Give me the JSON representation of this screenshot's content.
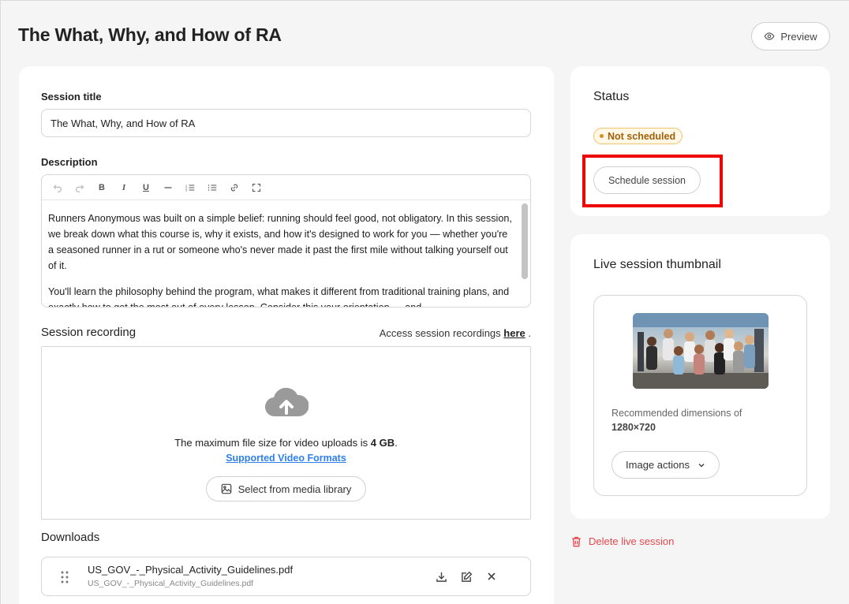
{
  "header": {
    "title": "The What, Why, and How of RA",
    "preview_label": "Preview"
  },
  "form": {
    "session_title_label": "Session title",
    "session_title_value": "The What, Why, and How of RA",
    "description_label": "Description",
    "description_paragraphs": [
      "Runners Anonymous was built on a simple belief: running should feel good, not obligatory. In this session, we break down what this course is, why it exists, and how it's designed to work for you — whether you're a seasoned runner in a rut or someone who's never made it past the first mile without talking yourself out of it.",
      "You'll learn the philosophy behind the program, what makes it different from traditional training plans, and exactly how to get the most out of every lesson. Consider this your orientation — and"
    ]
  },
  "recording": {
    "label": "Session recording",
    "access_prefix": "Access session recordings",
    "access_link": "here",
    "access_suffix": ".",
    "max_size_prefix": "The maximum file size for video uploads is",
    "max_size_value": "4 GB",
    "max_size_suffix": ".",
    "formats_link": "Supported Video Formats",
    "media_library_label": "Select from media library"
  },
  "downloads": {
    "label": "Downloads",
    "items": [
      {
        "name": "US_GOV_-_Physical_Activity_Guidelines.pdf",
        "filename": "US_GOV_-_Physical_Activity_Guidelines.pdf"
      }
    ]
  },
  "status": {
    "title": "Status",
    "badge": "Not scheduled",
    "schedule_label": "Schedule session"
  },
  "thumbnail": {
    "title": "Live session thumbnail",
    "recommended_text": "Recommended dimensions of",
    "recommended_dims": "1280×720",
    "image_actions_label": "Image actions"
  },
  "delete_label": "Delete live session",
  "colors": {
    "accent_link": "#2f80ed",
    "danger": "#e5484d",
    "status_badge_text": "#a0600b",
    "status_badge_bg": "#fff8e6",
    "highlight": "#ee0000"
  }
}
